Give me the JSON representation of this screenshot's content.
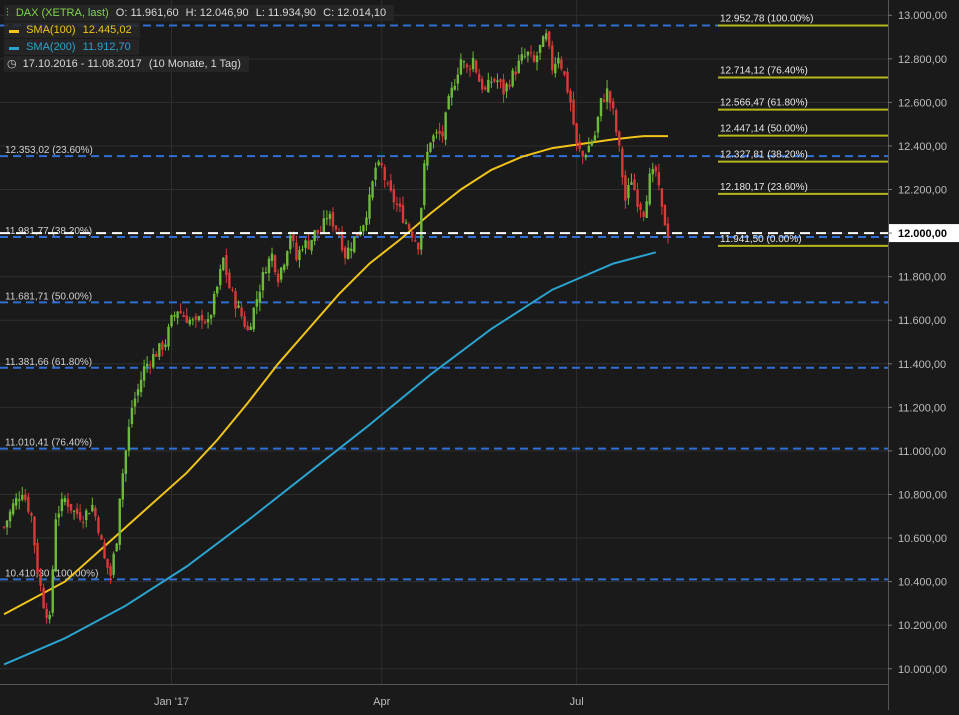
{
  "legend": {
    "instrument": "DAX (XETRA, last)",
    "open": "O: 11.961,60",
    "high": "H: 12.046,90",
    "low": "L: 11.934,90",
    "close": "C: 12.014,10",
    "sma100_label": "SMA(100)",
    "sma100_value": "12.445,02",
    "sma200_label": "SMA(200)",
    "sma200_value": "11.912,70",
    "period": "17.10.2016 - 11.08.2017",
    "period_detail": "(10 Monate, 1 Tag)"
  },
  "colors": {
    "background": "#1a1a1a",
    "grid": "#2e2e2e",
    "candle_up": "#6dbb38",
    "candle_down": "#d93a3a",
    "sma100": "#f0c419",
    "sma200": "#2aa3cf",
    "fib_left": "#2f6fd6",
    "fib_right": "#b5b81a",
    "price_line": "#ffffff",
    "axis_text": "#bdbdbd"
  },
  "chart_data": {
    "type": "candlestick",
    "ylim": [
      9930,
      13070
    ],
    "y_ticks": [
      10000,
      10200,
      10400,
      10600,
      10800,
      11000,
      11200,
      11400,
      11600,
      11800,
      12000,
      12200,
      12400,
      12600,
      12800,
      13000
    ],
    "y_tick_labels": [
      "10.000,00",
      "10.200,00",
      "10.400,00",
      "10.600,00",
      "10.800,00",
      "11.000,00",
      "11.200,00",
      "11.400,00",
      "11.600,00",
      "11.800,00",
      "12.000,00",
      "12.200,00",
      "12.400,00",
      "12.600,00",
      "12.800,00",
      "13.000,00"
    ],
    "x_labels": [
      {
        "text": "Jan '17",
        "day": 55
      },
      {
        "text": "Apr",
        "day": 124
      },
      {
        "text": "Jul",
        "day": 188
      }
    ],
    "total_days": 219,
    "current_price": 12000,
    "current_price_label": "12.000,00",
    "price_path": [
      [
        0,
        10650
      ],
      [
        3,
        10750
      ],
      [
        6,
        10820
      ],
      [
        9,
        10700
      ],
      [
        11,
        10450
      ],
      [
        13,
        10300
      ],
      [
        15,
        10220
      ],
      [
        17,
        10700
      ],
      [
        20,
        10780
      ],
      [
        23,
        10720
      ],
      [
        26,
        10700
      ],
      [
        29,
        10750
      ],
      [
        31,
        10650
      ],
      [
        33,
        10500
      ],
      [
        35,
        10430
      ],
      [
        37,
        10600
      ],
      [
        38,
        10800
      ],
      [
        40,
        11000
      ],
      [
        42,
        11200
      ],
      [
        44,
        11280
      ],
      [
        46,
        11380
      ],
      [
        48,
        11420
      ],
      [
        50,
        11450
      ],
      [
        53,
        11500
      ],
      [
        55,
        11600
      ],
      [
        57,
        11650
      ],
      [
        59,
        11620
      ],
      [
        61,
        11600
      ],
      [
        63,
        11580
      ],
      [
        65,
        11620
      ],
      [
        67,
        11580
      ],
      [
        70,
        11750
      ],
      [
        72,
        11880
      ],
      [
        74,
        11750
      ],
      [
        76,
        11680
      ],
      [
        78,
        11620
      ],
      [
        80,
        11550
      ],
      [
        82,
        11650
      ],
      [
        84,
        11750
      ],
      [
        86,
        11850
      ],
      [
        88,
        11900
      ],
      [
        90,
        11800
      ],
      [
        92,
        11880
      ],
      [
        94,
        12000
      ],
      [
        96,
        11880
      ],
      [
        98,
        11950
      ],
      [
        100,
        11950
      ],
      [
        102,
        12000
      ],
      [
        104,
        12000
      ],
      [
        106,
        12080
      ],
      [
        108,
        12050
      ],
      [
        110,
        12000
      ],
      [
        112,
        11900
      ],
      [
        114,
        11950
      ],
      [
        116,
        12000
      ],
      [
        118,
        12050
      ],
      [
        120,
        12150
      ],
      [
        122,
        12300
      ],
      [
        124,
        12300
      ],
      [
        126,
        12200
      ],
      [
        128,
        12150
      ],
      [
        130,
        12100
      ],
      [
        132,
        12050
      ],
      [
        134,
        12000
      ],
      [
        136,
        11950
      ],
      [
        138,
        12300
      ],
      [
        140,
        12430
      ],
      [
        142,
        12450
      ],
      [
        144,
        12450
      ],
      [
        146,
        12600
      ],
      [
        148,
        12700
      ],
      [
        150,
        12800
      ],
      [
        152,
        12750
      ],
      [
        154,
        12800
      ],
      [
        156,
        12700
      ],
      [
        158,
        12650
      ],
      [
        160,
        12700
      ],
      [
        162,
        12700
      ],
      [
        164,
        12650
      ],
      [
        166,
        12700
      ],
      [
        168,
        12750
      ],
      [
        170,
        12800
      ],
      [
        172,
        12820
      ],
      [
        174,
        12780
      ],
      [
        176,
        12850
      ],
      [
        178,
        12900
      ],
      [
        180,
        12760
      ],
      [
        182,
        12820
      ],
      [
        184,
        12720
      ],
      [
        186,
        12600
      ],
      [
        188,
        12400
      ],
      [
        190,
        12350
      ],
      [
        192,
        12400
      ],
      [
        194,
        12450
      ],
      [
        196,
        12600
      ],
      [
        198,
        12650
      ],
      [
        200,
        12550
      ],
      [
        202,
        12380
      ],
      [
        204,
        12150
      ],
      [
        206,
        12250
      ],
      [
        208,
        12150
      ],
      [
        210,
        12100
      ],
      [
        212,
        12250
      ],
      [
        214,
        12280
      ],
      [
        216,
        12100
      ],
      [
        218,
        12000
      ]
    ],
    "series": [
      {
        "name": "SMA(100)",
        "points": [
          [
            0,
            10250
          ],
          [
            20,
            10400
          ],
          [
            40,
            10650
          ],
          [
            60,
            10900
          ],
          [
            70,
            11050
          ],
          [
            80,
            11220
          ],
          [
            90,
            11400
          ],
          [
            100,
            11560
          ],
          [
            110,
            11720
          ],
          [
            120,
            11860
          ],
          [
            130,
            11970
          ],
          [
            140,
            12090
          ],
          [
            150,
            12200
          ],
          [
            160,
            12290
          ],
          [
            170,
            12350
          ],
          [
            180,
            12390
          ],
          [
            190,
            12410
          ],
          [
            200,
            12430
          ],
          [
            210,
            12445
          ],
          [
            218,
            12445
          ]
        ]
      },
      {
        "name": "SMA(200)",
        "points": [
          [
            0,
            10020
          ],
          [
            20,
            10140
          ],
          [
            40,
            10290
          ],
          [
            60,
            10470
          ],
          [
            80,
            10680
          ],
          [
            100,
            10900
          ],
          [
            120,
            11120
          ],
          [
            140,
            11350
          ],
          [
            160,
            11560
          ],
          [
            180,
            11740
          ],
          [
            200,
            11860
          ],
          [
            214,
            11912
          ]
        ]
      }
    ],
    "fib_left": [
      {
        "value": 12952.78,
        "label": ""
      },
      {
        "value": 12353.02,
        "label": "12.353,02 (23.60%)"
      },
      {
        "value": 11981.77,
        "label": "11.981,77 (38.20%)"
      },
      {
        "value": 11681.71,
        "label": "11.681,71 (50.00%)"
      },
      {
        "value": 11381.66,
        "label": "11.381,66 (61.80%)"
      },
      {
        "value": 11010.41,
        "label": "11.010,41 (76.40%)"
      },
      {
        "value": 10410.3,
        "label": "10.410,30 (100.00%)"
      }
    ],
    "fib_right": [
      {
        "value": 12952.78,
        "label": "12.952,78 (100.00%)"
      },
      {
        "value": 12714.12,
        "label": "12.714,12 (76.40%)"
      },
      {
        "value": 12566.47,
        "label": "12.566,47 (61.80%)"
      },
      {
        "value": 12447.14,
        "label": "12.447,14 (50.00%)"
      },
      {
        "value": 12327.81,
        "label": "12.327,81 (38.20%)"
      },
      {
        "value": 12180.17,
        "label": "12.180,17 (23.60%)"
      },
      {
        "value": 11941.5,
        "label": "11.941,50 (0.00%)"
      }
    ]
  }
}
